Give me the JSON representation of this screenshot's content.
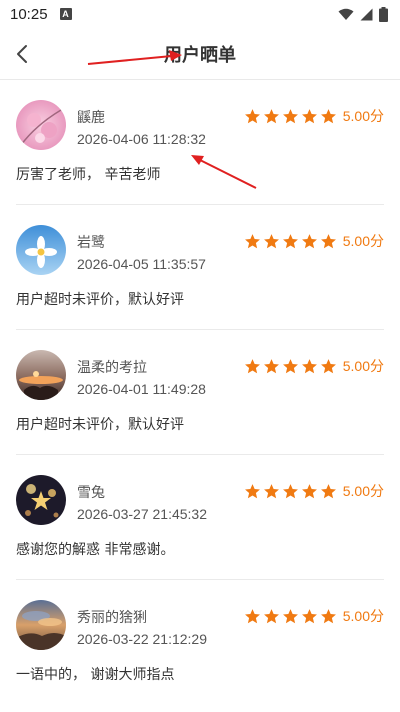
{
  "status": {
    "time": "10:25",
    "badge": "A"
  },
  "nav": {
    "title": "用户晒单"
  },
  "accent": "#f07a12",
  "reviews": [
    {
      "name": "鼷鹿",
      "time": "2026-04-06 11:28:32",
      "rating": 5,
      "score": "5.00分",
      "comment": "厉害了老师， 辛苦老师"
    },
    {
      "name": "岩鹭",
      "time": "2026-04-05 11:35:57",
      "rating": 5,
      "score": "5.00分",
      "comment": "用户超时未评价，默认好评"
    },
    {
      "name": "温柔的考拉",
      "time": "2026-04-01 11:49:28",
      "rating": 5,
      "score": "5.00分",
      "comment": "用户超时未评价，默认好评"
    },
    {
      "name": "雪兔",
      "time": "2026-03-27 21:45:32",
      "rating": 5,
      "score": "5.00分",
      "comment": "感谢您的解惑 非常感谢。"
    },
    {
      "name": "秀丽的猞猁",
      "time": "2026-03-22 21:12:29",
      "rating": 5,
      "score": "5.00分",
      "comment": "一语中的， 谢谢大师指点"
    }
  ]
}
